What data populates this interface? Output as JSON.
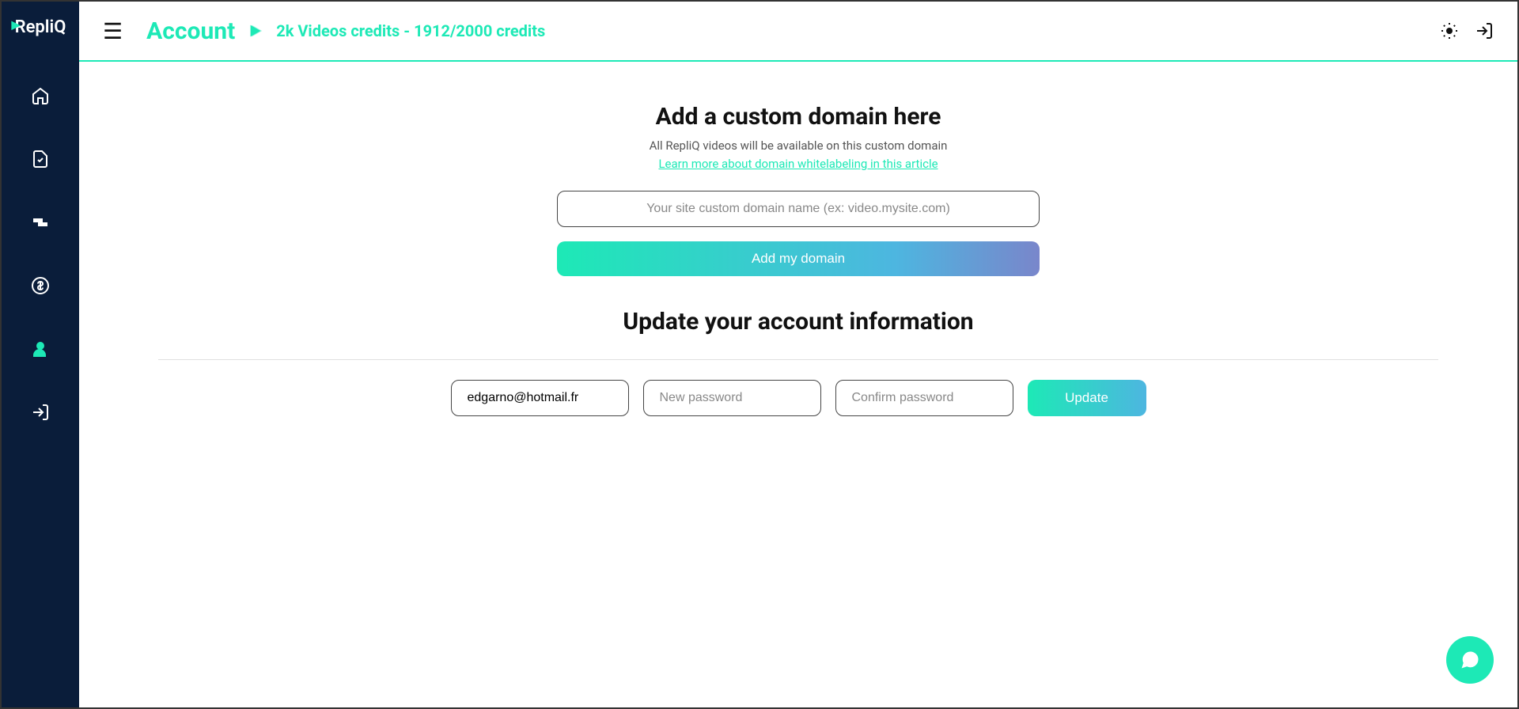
{
  "brand": "RepliQ",
  "header": {
    "title": "Account",
    "credits": "2k Videos credits - 1912/2000 credits"
  },
  "domain_section": {
    "title": "Add a custom domain here",
    "subtitle": "All RepliQ videos will be available on this custom domain",
    "link": "Learn more about domain whitelabeling in this article",
    "input_placeholder": "Your site custom domain name (ex: video.mysite.com)",
    "button": "Add my domain"
  },
  "account_section": {
    "title": "Update your account information",
    "email_value": "edgarno@hotmail.fr",
    "new_password_placeholder": "New password",
    "confirm_password_placeholder": "Confirm password",
    "button": "Update"
  }
}
